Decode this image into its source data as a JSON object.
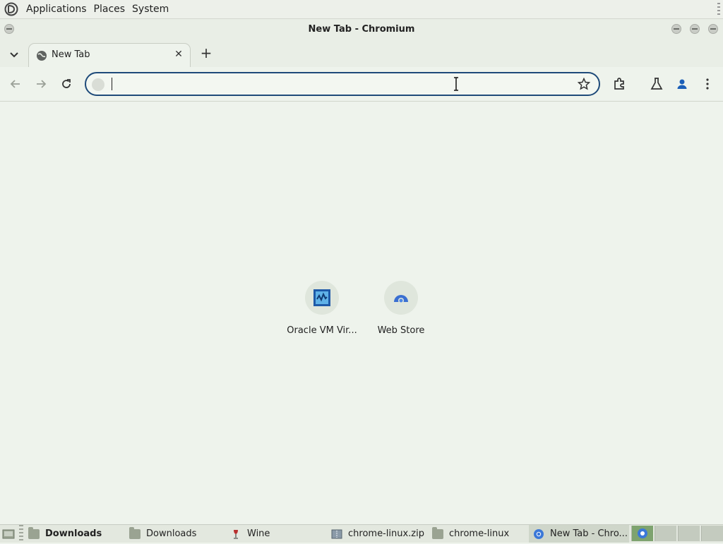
{
  "top_panel": {
    "menus": [
      "Applications",
      "Places",
      "System"
    ]
  },
  "window": {
    "title": "New Tab - Chromium"
  },
  "tabs": [
    {
      "title": "New Tab",
      "active": true
    }
  ],
  "omnibox": {
    "value": "",
    "placeholder": ""
  },
  "shortcuts": [
    {
      "label": "Oracle VM Vir...",
      "icon": "virtualbox-icon"
    },
    {
      "label": "Web Store",
      "icon": "web-store-icon"
    }
  ],
  "taskbar": {
    "items": [
      {
        "label": "Downloads",
        "icon": "folder-icon",
        "bold": true
      },
      {
        "label": "Downloads",
        "icon": "folder-icon"
      },
      {
        "label": "Wine",
        "icon": "wine-icon"
      },
      {
        "label": "chrome-linux.zip",
        "icon": "archive-icon"
      },
      {
        "label": "chrome-linux",
        "icon": "folder-icon"
      },
      {
        "label": "New Tab - Chro...",
        "icon": "chromium-icon",
        "active": true
      }
    ]
  },
  "colors": {
    "accent": "#1f4b7a",
    "background": "#eef3ec",
    "panel": "#e3e8df"
  }
}
